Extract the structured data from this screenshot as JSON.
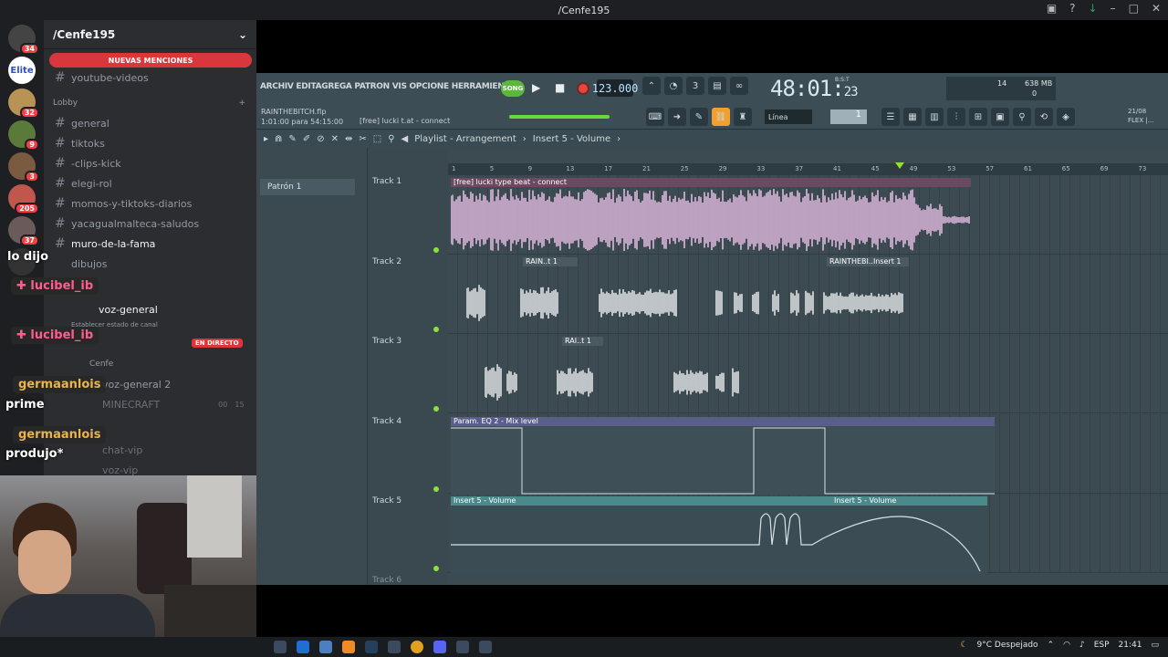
{
  "window": {
    "title": "/Cenfe195"
  },
  "server": {
    "name": "/Cenfe195",
    "mentions_label": "NUEVAS MENCIONES",
    "servers": [
      {
        "label": "",
        "badge": "34"
      },
      {
        "label": "Elite",
        "badge": ""
      },
      {
        "label": "",
        "badge": "32"
      },
      {
        "label": "",
        "badge": "9"
      },
      {
        "label": "",
        "badge": "3"
      },
      {
        "label": "",
        "badge": "205"
      },
      {
        "label": "",
        "badge": "37"
      },
      {
        "label": "",
        "badge": ""
      }
    ],
    "channels_top": [
      {
        "name": "youtube-videos"
      }
    ],
    "lobby_label": "Lobby",
    "channels": [
      {
        "name": "general"
      },
      {
        "name": "tiktoks"
      },
      {
        "name": "-clips-kick"
      },
      {
        "name": "elegi-rol"
      },
      {
        "name": "momos-y-tiktoks-diarios"
      },
      {
        "name": "yacagualmalteca-saludos"
      },
      {
        "name": "muro-de-la-fama"
      },
      {
        "name": "dibujos"
      }
    ],
    "voice": {
      "name": "voz-general",
      "status": "Establecer estado de canal",
      "live": "EN DIRECTO",
      "user": "Cenfe",
      "voice2": "voz-general 2",
      "minecraft": "MINECRAFT",
      "mc_count_a": "00",
      "mc_count_b": "15",
      "chat_vip": "chat-vip",
      "voz_vip": "voz-vip"
    }
  },
  "overlay": {
    "chat": [
      {
        "user": "lucibel_ib",
        "text": "lo dijo"
      },
      {
        "user": "lucibel_ib",
        "text": ""
      },
      {
        "user": "germaanlois",
        "text": "prime"
      },
      {
        "user": "germaanlois",
        "text": "produjo*"
      }
    ]
  },
  "fl": {
    "menu": "ARCHIV EDITAGREGA PATRON  VIS OPCIONE HERRAMIENTA",
    "song_label": "SONG",
    "tempo": "123.000",
    "time_main": "48:01",
    "time_sub": "23",
    "time_unit": "B:S:T",
    "project_file": "RAINTHEBITCH.flp",
    "project_time": "1:01:00 para 54:15:00",
    "hint": "[free] lucki t.at - connect",
    "memory": "638 MB",
    "mem_val": "14",
    "mem_zero": "0",
    "snap": "Línea",
    "pattern_num": "1",
    "date": "21/08",
    "flex": "FLEX |...",
    "playlist_title": "Playlist - Arrangement",
    "playlist_insert": "Insert 5 - Volume",
    "pattern_name": "Patrón 1",
    "tracks": [
      {
        "name": "Track 1"
      },
      {
        "name": "Track 2"
      },
      {
        "name": "Track 3"
      },
      {
        "name": "Track 4"
      },
      {
        "name": "Track 5"
      },
      {
        "name": "Track 6"
      }
    ],
    "ruler": [
      "1",
      "5",
      "9",
      "13",
      "17",
      "21",
      "25",
      "29",
      "33",
      "37",
      "41",
      "45",
      "49",
      "53",
      "57",
      "61",
      "65",
      "69",
      "73"
    ],
    "clip1": "[free] lucki type beat - connect",
    "clip2a": "RAIN..t 1",
    "clip2b": "RAINTHEBI..Insert 1",
    "clip3": "RAI..t 1",
    "clip4": "Param. EQ 2 - Mix level",
    "clip5": "Insert 5 - Volume"
  },
  "taskbar": {
    "weather": "9°C Despejado",
    "lang": "ESP",
    "time": "21:41"
  },
  "colors": {
    "discord_bg": "#2b2d31",
    "fl_bg": "#34444c",
    "audio_clip": "#d8b4d8",
    "automation_clip": "#5a8b8f",
    "live_red": "#da373c"
  }
}
